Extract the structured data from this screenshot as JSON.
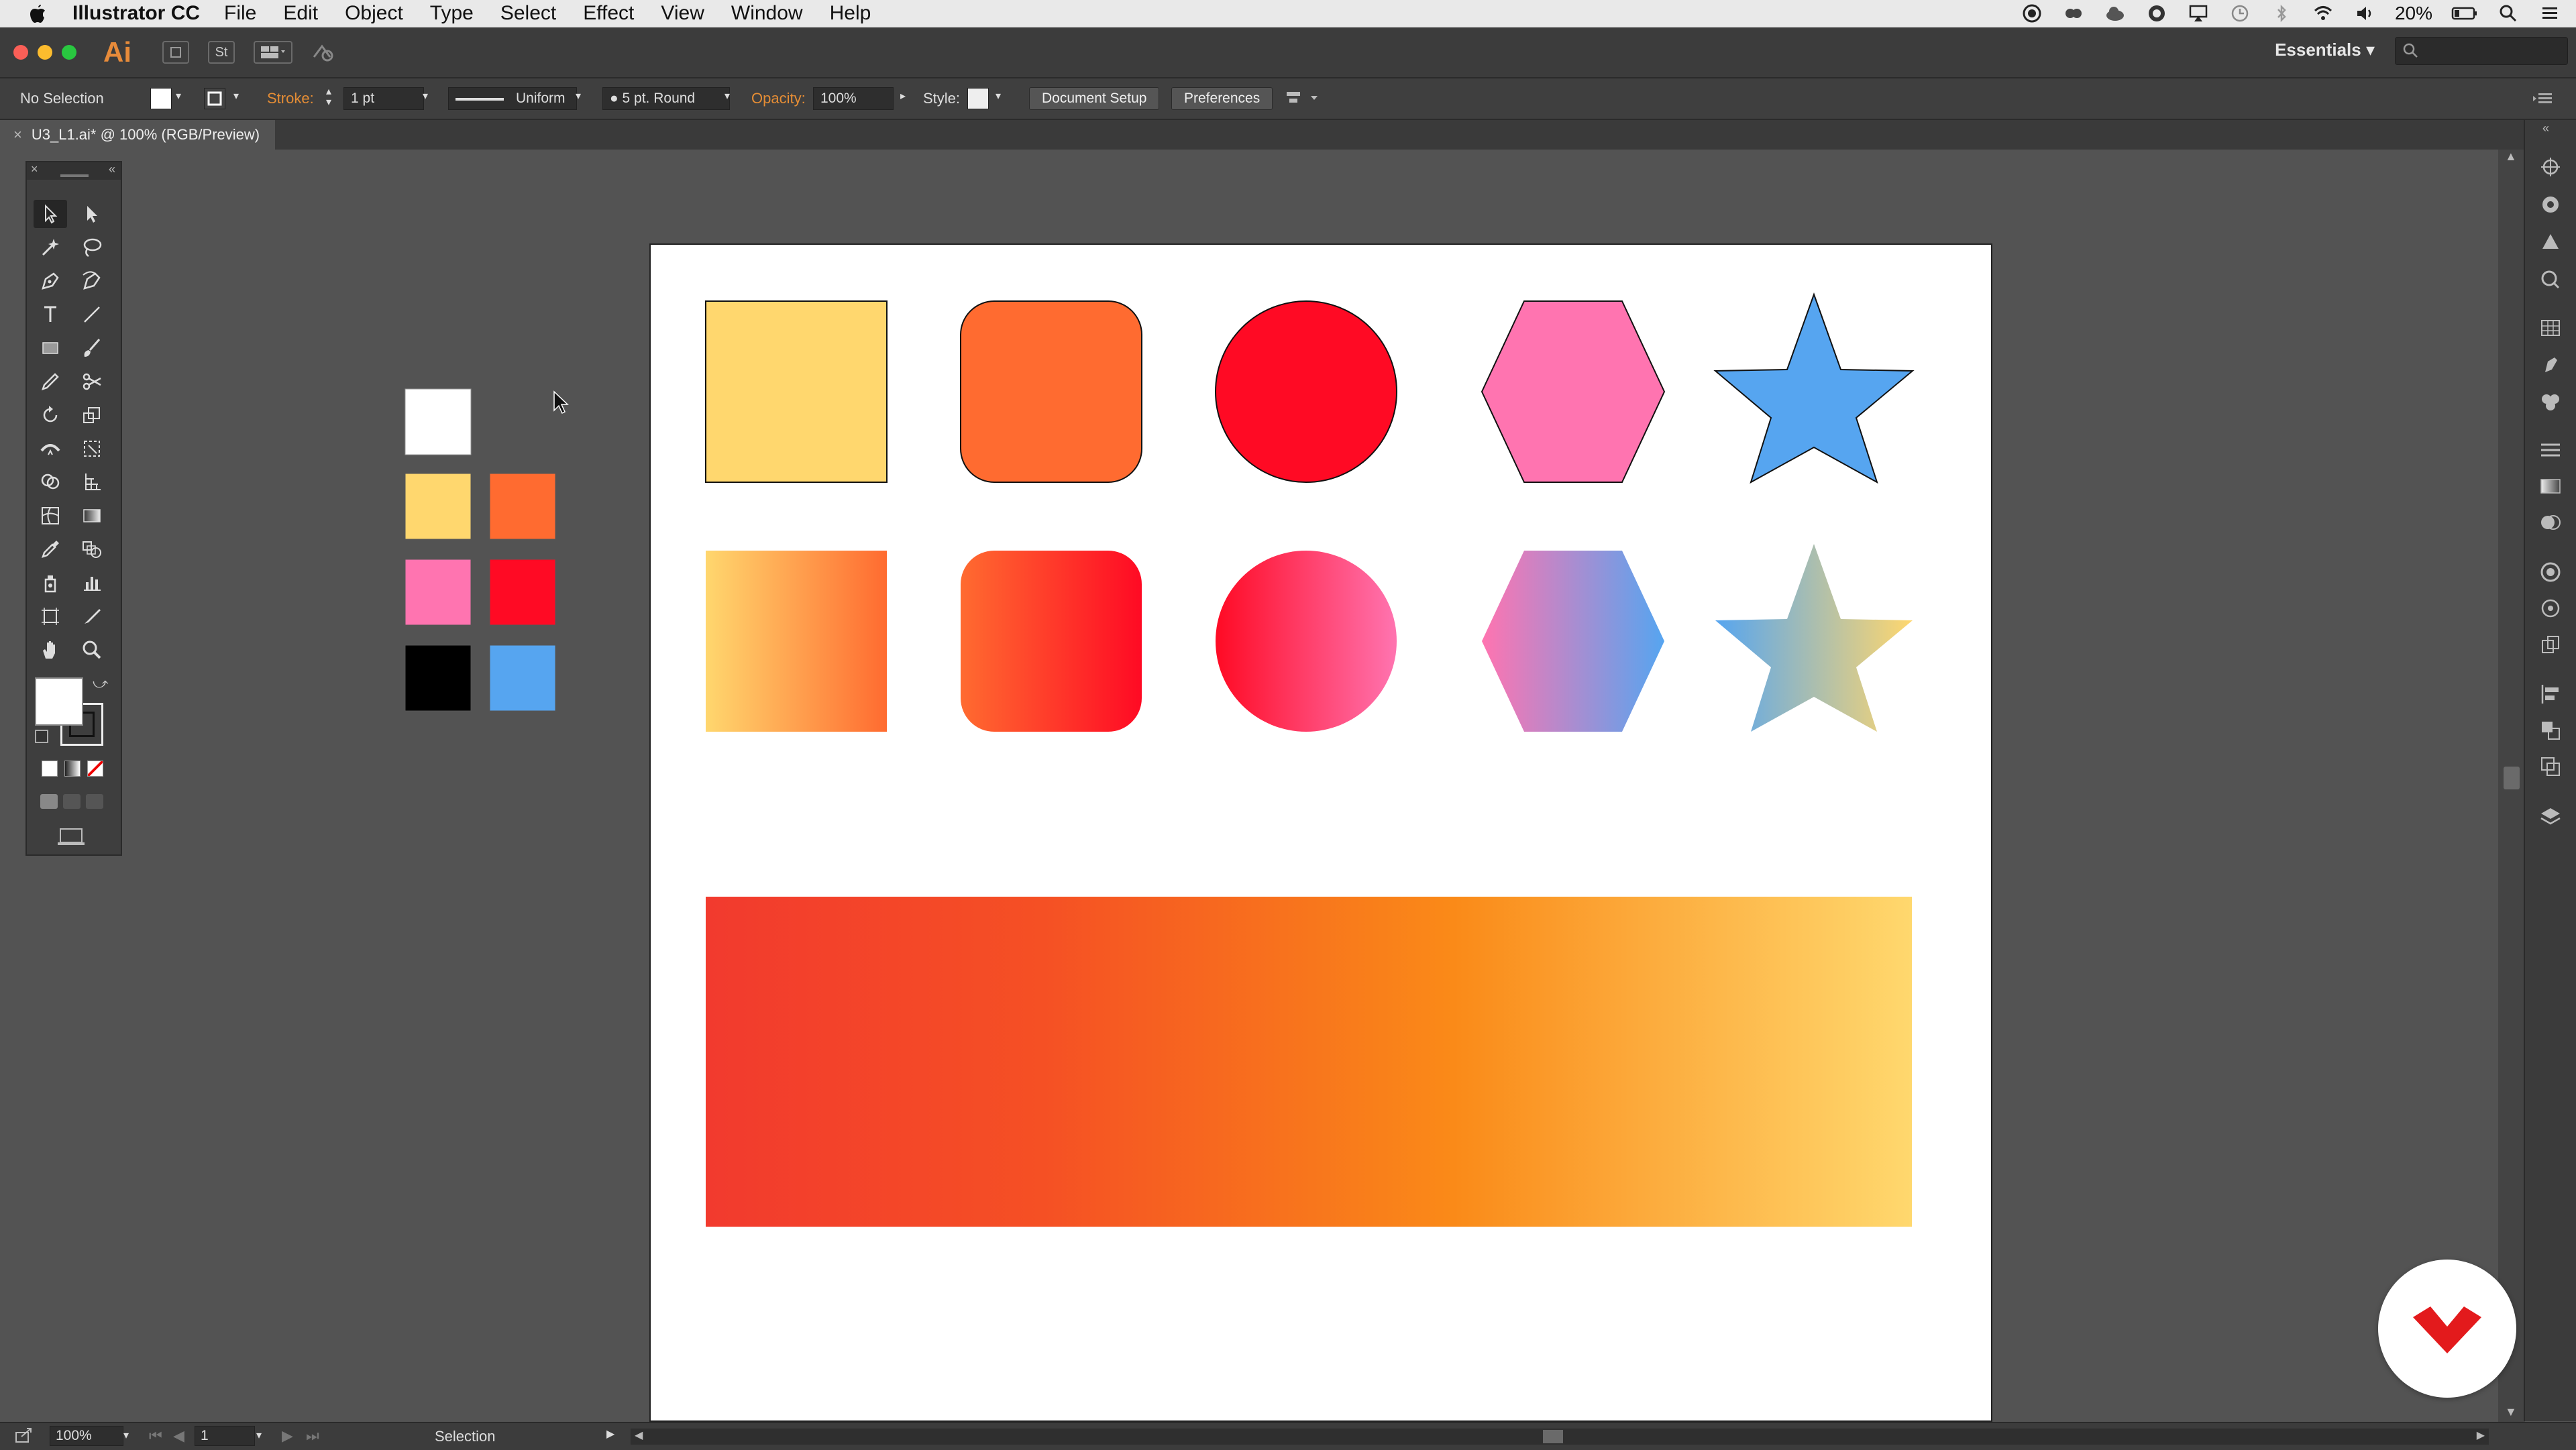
{
  "menubar": {
    "app_name": "Illustrator CC",
    "menus": [
      "File",
      "Edit",
      "Object",
      "Type",
      "Select",
      "Effect",
      "View",
      "Window",
      "Help"
    ],
    "battery": "20%"
  },
  "appbar": {
    "logo": "Ai",
    "workspace": "Essentials",
    "arrange_label": "St"
  },
  "control": {
    "selection": "No Selection",
    "stroke_label": "Stroke:",
    "stroke_weight": "1 pt",
    "profile": "Uniform",
    "brush": "5 pt. Round",
    "opacity_label": "Opacity:",
    "opacity": "100%",
    "style_label": "Style:",
    "document_setup": "Document Setup",
    "preferences": "Preferences"
  },
  "tab": {
    "title": "U3_L1.ai* @ 100% (RGB/Preview)",
    "close": "×"
  },
  "status": {
    "zoom": "100%",
    "artboard": "1",
    "tool": "Selection"
  },
  "colors": {
    "yellow": "#FFD76E",
    "orange": "#FF6B30",
    "red": "#FF0A24",
    "pink": "#FF74B0",
    "blue": "#56A5F0",
    "black": "#000000",
    "white": "#FFFFFF"
  }
}
